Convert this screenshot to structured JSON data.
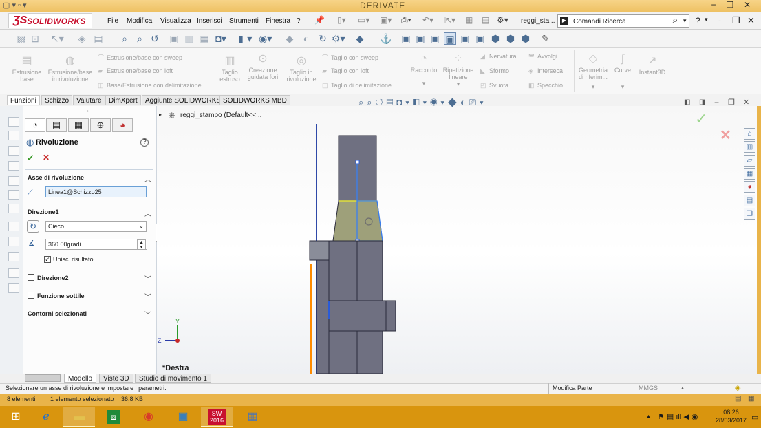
{
  "window": {
    "title": "DERIVATE",
    "doc_name": "reggi_sta...",
    "search_placeholder": "Comandi Ricerca",
    "controls": [
      "?",
      "-",
      "❐",
      "✕"
    ]
  },
  "app": {
    "logo_text": "SOLIDWORKS"
  },
  "menu": [
    "File",
    "Modifica",
    "Visualizza",
    "Inserisci",
    "Strumenti",
    "Finestra",
    "?"
  ],
  "command_manager": {
    "large": [
      {
        "label": "Estrusione base"
      },
      {
        "label": "Estrusione/base in rivoluzione"
      },
      {
        "label": "Taglio estruso"
      },
      {
        "label": "Creazione guidata fori"
      },
      {
        "label": "Taglio in rivoluzione"
      },
      {
        "label": "Raccordo"
      },
      {
        "label": "Ripetizione lineare"
      },
      {
        "label": "Geometria di riferim..."
      },
      {
        "label": "Curve"
      },
      {
        "label": "Instant3D"
      }
    ],
    "small": [
      "Estrusione/base con sweep",
      "Estrusione/base con loft",
      "Base/Estrusione con delimitazione",
      "Taglio con sweep",
      "Taglio con loft",
      "Taglio di delimitazione",
      "Nervatura",
      "Avvolgi",
      "Sformo",
      "Interseca",
      "Svuota",
      "Specchio"
    ]
  },
  "tabs": [
    "Funzioni",
    "Schizzo",
    "Valutare",
    "DimXpert",
    "Aggiunte SOLIDWORKS",
    "SOLIDWORKS MBD"
  ],
  "feature_tree": {
    "root": "reggi_stampo  (Default<<..."
  },
  "property_manager": {
    "title": "Rivoluzione",
    "axis_section": "Asse di rivoluzione",
    "axis_value": "Linea1@Schizzo25",
    "direction1": "Direzione1",
    "end_condition": "Cieco",
    "angle": "360.00gradi",
    "merge_label": "Unisci risultato",
    "merge_checked": true,
    "direction2": "Direzione2",
    "thin_feature": "Funzione sottile",
    "selected_contours": "Contorni selezionati"
  },
  "viewport": {
    "view_label": "*Destra",
    "axis_y": "Y",
    "axis_z": "Z"
  },
  "bottom_tabs": [
    "Modello",
    "Viste 3D",
    "Studio di movimento 1"
  ],
  "status": {
    "message": "Selezionare un asse di rivoluzione e impostare i parametri.",
    "mode": "Modifica Parte",
    "units": "MMGS"
  },
  "info": {
    "elements": "8 elementi",
    "selection": "1 elemento selezionato",
    "size": "36,8 KB"
  },
  "taskbar": {
    "sw_badge": "2016",
    "time": "08:26",
    "date": "28/03/2017"
  },
  "colors": {
    "accent_orange": "#e9b44a",
    "taskbar": "#d9950e",
    "part": "#6f7081",
    "selection": "#2a6fd8",
    "logo_red": "#c8102e"
  }
}
